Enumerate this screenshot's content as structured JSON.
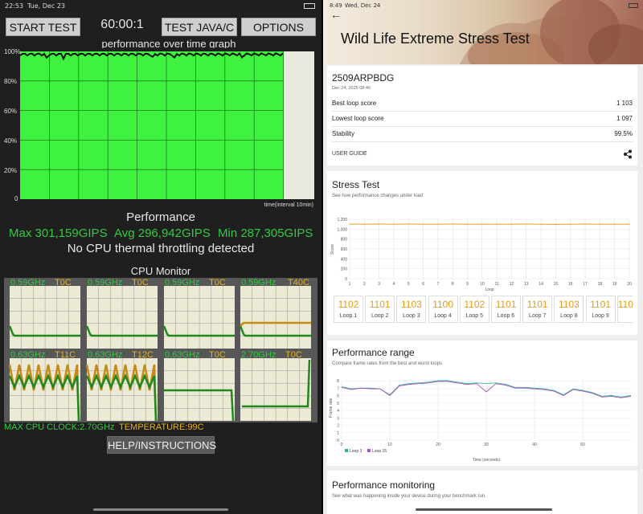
{
  "left": {
    "status": {
      "time": "22:53",
      "date": "Tue, Dec 23"
    },
    "toolbar": {
      "start": "START TEST",
      "timer": "60:00:1",
      "java": "TEST JAVA/C",
      "options": "OPTIONS"
    },
    "graph": {
      "title": "performance over time graph",
      "yticks": [
        "100%",
        "80%",
        "60%",
        "40%",
        "20%",
        "0"
      ],
      "xlabel": "time(interval 10min)",
      "performance_level": 0.98
    },
    "performance": {
      "heading": "Performance",
      "max": "Max 301,159GIPS",
      "avg": "Avg 296,942GIPS",
      "min": "Min 287,305GIPS",
      "throttle": "No CPU thermal throttling detected"
    },
    "cpu": {
      "heading": "CPU Monitor",
      "cores": [
        {
          "freq": "0.59GHz",
          "temp": "T0C"
        },
        {
          "freq": "0.59GHz",
          "temp": "T0C"
        },
        {
          "freq": "0.59GHz",
          "temp": "T0C"
        },
        {
          "freq": "0.59GHz",
          "temp": "T40C"
        },
        {
          "freq": "0.63GHz",
          "temp": "T11C"
        },
        {
          "freq": "0.63GHz",
          "temp": "T12C"
        },
        {
          "freq": "0.63GHz",
          "temp": "T0C"
        },
        {
          "freq": "2.70GHz",
          "temp": "T0C"
        }
      ],
      "max_clock": "MAX CPU CLOCK:2.70GHz",
      "temperature": "TEMPERATURE:99C"
    },
    "help": "HELP/INSTRUCTIONS",
    "colors": {
      "graph_fill": "#3ff23f",
      "freq": "#2ecc40",
      "temp": "#e7b21a"
    }
  },
  "right": {
    "status": {
      "time": "8:49",
      "date": "Wed, Dec 24"
    },
    "title": "Wild Life Extreme Stress Test",
    "summary": {
      "device": "2509ARPBDG",
      "date": "Dec 24, 2025 08:46",
      "best_label": "Best loop score",
      "best": "1 103",
      "lowest_label": "Lowest loop score",
      "lowest": "1 097",
      "stability_label": "Stability",
      "stability": "99.5%",
      "guide": "USER GUIDE"
    },
    "stress": {
      "title": "Stress Test",
      "subtitle": "See how performance changes under load",
      "ylabel": "Score",
      "xlabel": "Loop",
      "yticks": [
        "1,200",
        "1,000",
        "800",
        "600",
        "400",
        "200",
        "0"
      ],
      "loops": [
        {
          "score": "1102",
          "label": "Loop 1"
        },
        {
          "score": "1101",
          "label": "Loop 2"
        },
        {
          "score": "1103",
          "label": "Loop 3"
        },
        {
          "score": "1100",
          "label": "Loop 4"
        },
        {
          "score": "1102",
          "label": "Loop 5"
        },
        {
          "score": "1101",
          "label": "Loop 6"
        },
        {
          "score": "1101",
          "label": "Loop 7"
        },
        {
          "score": "1103",
          "label": "Loop 8"
        },
        {
          "score": "1101",
          "label": "Loop 9"
        },
        {
          "score": "110",
          "label": ""
        }
      ]
    },
    "range": {
      "title": "Performance range",
      "subtitle": "Compare frame rates from the best and worst loops",
      "ylabel": "Frame rate",
      "xlabel": "Time (seconds)",
      "yticks": [
        "8",
        "7",
        "6",
        "5",
        "4",
        "3",
        "2",
        "1",
        "0"
      ],
      "xticks": [
        "0",
        "10",
        "20",
        "30",
        "40",
        "50"
      ],
      "legend": [
        "Loop 3",
        "Loop 15"
      ],
      "colors": [
        "#2db88a",
        "#b34fc7"
      ]
    },
    "monitoring": {
      "title": "Performance monitoring",
      "subtitle": "See what was happening inside your device during your benchmark run."
    },
    "colors": {
      "accent": "#e49a1d"
    }
  },
  "chart_data": [
    {
      "type": "line",
      "title": "Stress Test",
      "xlabel": "Loop",
      "ylabel": "Score",
      "x": [
        1,
        2,
        3,
        4,
        5,
        6,
        7,
        8,
        9,
        10,
        11,
        12,
        13,
        14,
        15,
        16,
        17,
        18,
        19,
        20
      ],
      "series": [
        {
          "values": [
            1102,
            1101,
            1103,
            1100,
            1102,
            1101,
            1101,
            1103,
            1101,
            1101,
            1100,
            1101,
            1102,
            1101,
            1097,
            1101,
            1102,
            1100,
            1101,
            1101
          ]
        }
      ],
      "ylim": [
        0,
        1200
      ],
      "grid": true
    },
    {
      "type": "line",
      "title": "Performance range",
      "xlabel": "Time (seconds)",
      "ylabel": "Frame rate",
      "x": [
        0,
        2,
        4,
        6,
        8,
        10,
        12,
        14,
        16,
        18,
        20,
        22,
        24,
        26,
        28,
        30,
        32,
        34,
        36,
        38,
        40,
        42,
        44,
        46,
        48,
        50,
        52,
        54,
        56,
        58,
        60
      ],
      "series": [
        {
          "name": "Loop 3",
          "values": [
            7.2,
            6.9,
            7.0,
            7.0,
            6.9,
            6.1,
            7.4,
            7.6,
            7.7,
            7.8,
            8.0,
            8.0,
            7.8,
            7.6,
            7.7,
            7.6,
            7.7,
            7.5,
            7.1,
            7.1,
            7.0,
            6.9,
            6.7,
            6.1,
            6.9,
            6.7,
            6.4,
            5.9,
            6.0,
            5.8,
            6.0
          ]
        },
        {
          "name": "Loop 15",
          "values": [
            7.1,
            6.8,
            7.0,
            6.9,
            6.9,
            6.0,
            7.3,
            7.5,
            7.6,
            7.7,
            7.9,
            7.9,
            7.7,
            7.5,
            7.6,
            6.5,
            7.6,
            7.4,
            7.0,
            7.0,
            6.9,
            6.8,
            6.6,
            6.0,
            6.8,
            6.6,
            6.3,
            5.8,
            5.9,
            5.7,
            5.9
          ]
        }
      ],
      "ylim": [
        0,
        8
      ],
      "grid": true,
      "legend": "bottom-left"
    }
  ]
}
